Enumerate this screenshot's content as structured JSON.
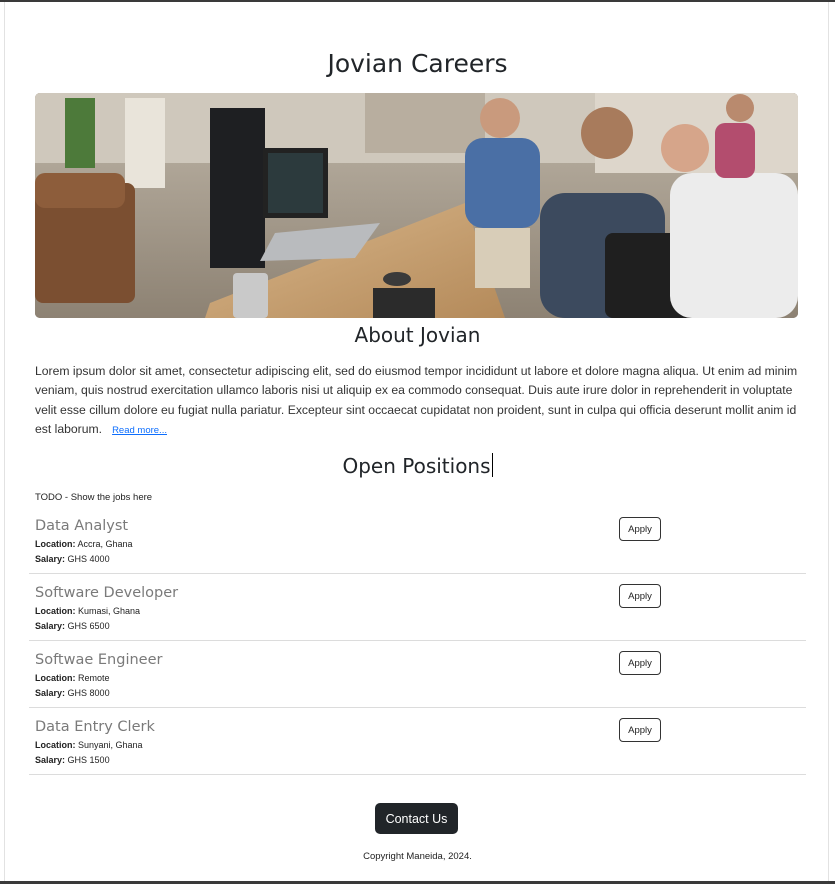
{
  "header": {
    "title": "Jovian Careers"
  },
  "hero": {
    "image_description_icon": "office-team-photo"
  },
  "about": {
    "title": "About Jovian",
    "body": "Lorem ipsum dolor sit amet, consectetur adipiscing elit, sed do eiusmod tempor incididunt ut labore et dolore magna aliqua. Ut enim ad minim veniam, quis nostrud exercitation ullamco laboris nisi ut aliquip ex ea commodo consequat. Duis aute irure dolor in reprehenderit in voluptate velit esse cillum dolore eu fugiat nulla pariatur. Excepteur sint occaecat cupidatat non proident, sunt in culpa qui officia deserunt mollit anim id est laborum.",
    "read_more": "Read more..."
  },
  "positions": {
    "title": "Open Positions",
    "todo": "TODO - Show the jobs here",
    "location_label": "Location:",
    "salary_label": "Salary:",
    "apply_label": "Apply",
    "jobs": [
      {
        "title": "Data Analyst",
        "location": "Accra, Ghana",
        "salary": "GHS 4000"
      },
      {
        "title": "Software Developer",
        "location": "Kumasi, Ghana",
        "salary": "GHS 6500"
      },
      {
        "title": "Softwae Engineer",
        "location": "Remote",
        "salary": "GHS 8000"
      },
      {
        "title": "Data Entry Clerk",
        "location": "Sunyani, Ghana",
        "salary": "GHS 1500"
      }
    ]
  },
  "footer": {
    "contact_label": "Contact Us",
    "copyright": "Copyright Maneida, 2024."
  },
  "colors": {
    "dark_button": "#212529",
    "link": "#0d6efd",
    "job_title": "#7a7a7a"
  }
}
